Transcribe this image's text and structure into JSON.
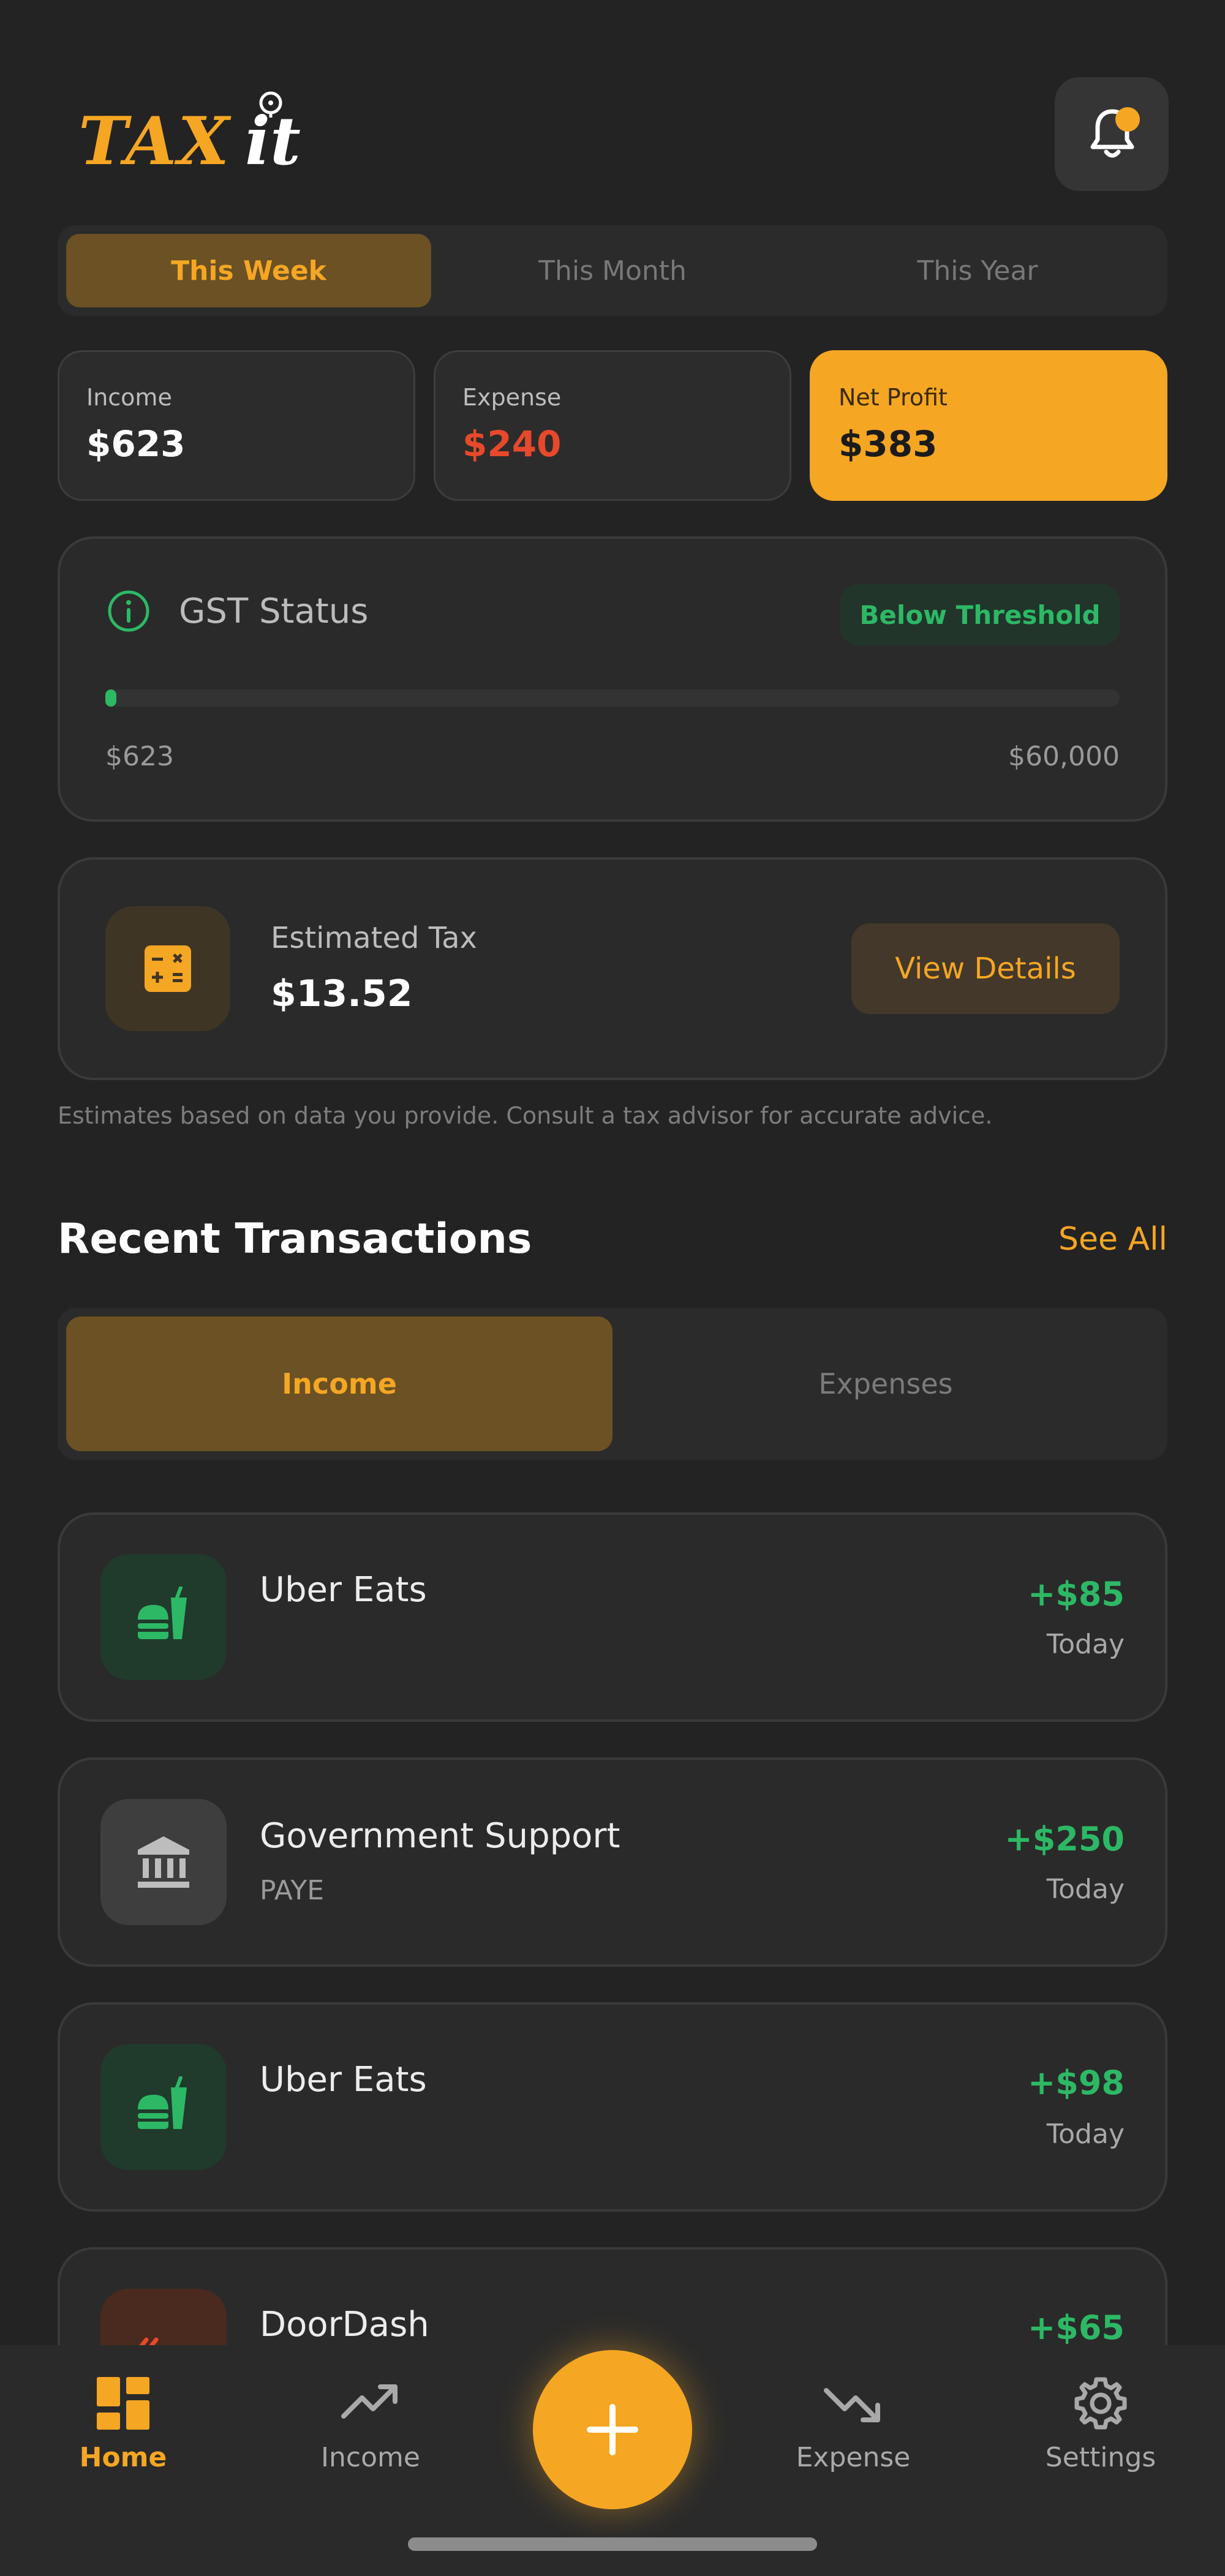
{
  "app": {
    "logo_text": "TAXit",
    "bell_icon": "bell-icon",
    "accent_color": "#F5A623",
    "positive_color": "#2DB865",
    "negative_color": "#E8482B"
  },
  "period_tabs": [
    {
      "label": "This Week",
      "active": true
    },
    {
      "label": "This Month",
      "active": false
    },
    {
      "label": "This Year",
      "active": false
    }
  ],
  "stats": {
    "income": {
      "label": "Income",
      "value": "$623"
    },
    "expense": {
      "label": "Expense",
      "value": "$240"
    },
    "net_profit": {
      "label": "Net Profit",
      "value": "$383"
    }
  },
  "gst": {
    "icon": "info-icon",
    "title": "GST Status",
    "badge": "Below Threshold",
    "current": "$623",
    "threshold": "$60,000",
    "progress_fraction": 0.0104
  },
  "tax": {
    "icon": "calculator-icon",
    "label": "Estimated Tax",
    "value": "$13.52",
    "button": "View Details"
  },
  "disclaimer": "Estimates based on data you provide. Consult a tax advisor for accurate advice.",
  "recent": {
    "title": "Recent Transactions",
    "see_all": "See All",
    "tabs": [
      {
        "label": "Income",
        "active": true
      },
      {
        "label": "Expenses",
        "active": false
      }
    ],
    "items": [
      {
        "name": "Uber Eats",
        "sub": "",
        "amount": "+$85",
        "date": "Today",
        "icon": "food-icon"
      },
      {
        "name": "Government Support",
        "sub": "PAYE",
        "amount": "+$250",
        "date": "Today",
        "icon": "bank-icon"
      },
      {
        "name": "Uber Eats",
        "sub": "",
        "amount": "+$98",
        "date": "Today",
        "icon": "food-icon"
      },
      {
        "name": "DoorDash",
        "sub": "",
        "amount": "+$65",
        "date": "",
        "icon": "doordash-icon"
      }
    ]
  },
  "nav": {
    "home": "Home",
    "income": "Income",
    "add": "+",
    "expense": "Expense",
    "settings": "Settings"
  }
}
